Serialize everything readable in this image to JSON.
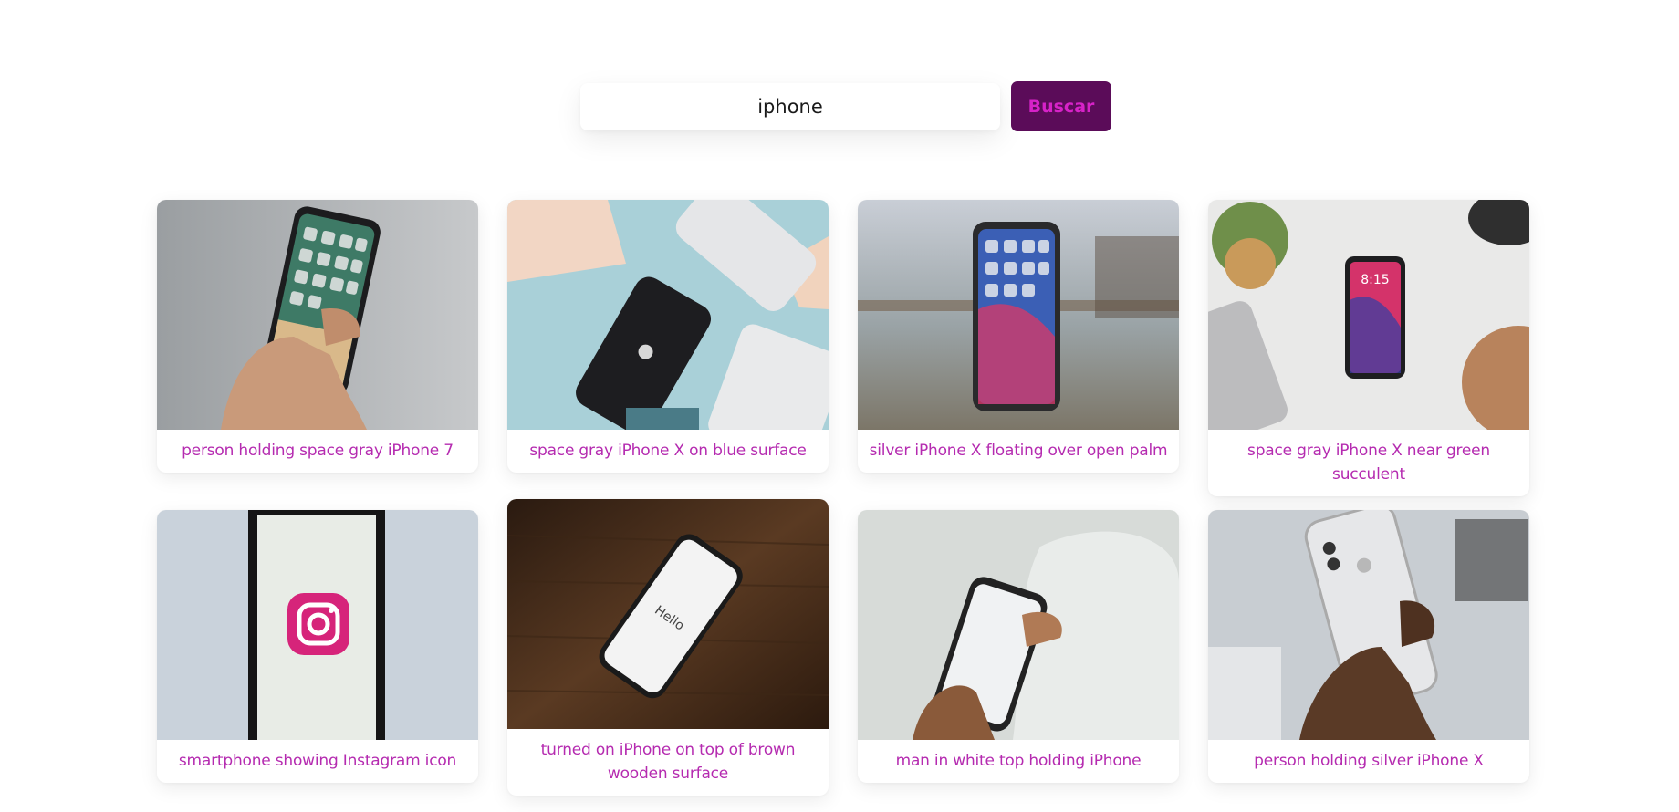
{
  "search": {
    "value": "iphone",
    "button_label": "Buscar"
  },
  "colors": {
    "button_bg": "#5b0c59",
    "button_text": "#d722c8",
    "caption_text": "#b52bb0"
  },
  "results": [
    {
      "caption": "person holding space gray iPhone 7"
    },
    {
      "caption": "space gray iPhone X on blue surface"
    },
    {
      "caption": "silver iPhone X floating over open palm"
    },
    {
      "caption": "space gray iPhone X near green succulent"
    },
    {
      "caption": "smartphone showing Instagram icon",
      "icon": "instagram-icon"
    },
    {
      "caption": "turned on iPhone on top of brown wooden surface",
      "screen_text": "Hello"
    },
    {
      "caption": "man in white top holding iPhone"
    },
    {
      "caption": "person holding silver iPhone X"
    }
  ]
}
